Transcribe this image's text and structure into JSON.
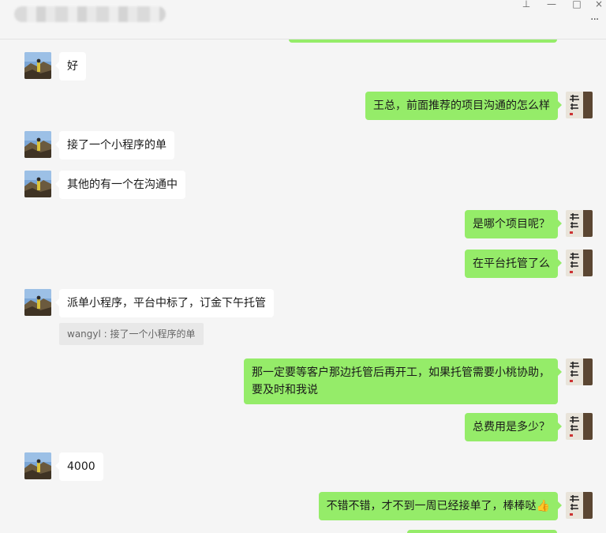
{
  "window": {
    "controls": {
      "pin_icon": "pin-icon",
      "min_icon": "minimize-icon",
      "max_icon": "maximize-icon",
      "close_icon": "close-icon",
      "more_icon": "more-icon"
    }
  },
  "colors": {
    "background": "#f5f5f5",
    "outgoing_bubble": "#95ec69",
    "incoming_bubble": "#ffffff",
    "quote_background": "#e8e8e8"
  },
  "messages": [
    {
      "direction": "in",
      "text": "好"
    },
    {
      "direction": "out",
      "text": "王总，前面推荐的项目沟通的怎么样"
    },
    {
      "direction": "in",
      "text": "接了一个小程序的单"
    },
    {
      "direction": "in",
      "text": "其他的有一个在沟通中"
    },
    {
      "direction": "out",
      "text": "是哪个项目呢？"
    },
    {
      "direction": "out",
      "text": "在平台托管了么"
    },
    {
      "direction": "in",
      "text": "派单小程序，平台中标了，订金下午托管",
      "quote": "wangyl : 接了一个小程序的单"
    },
    {
      "direction": "out",
      "text": "那一定要等客户那边托管后再开工，如果托管需要小桃协助，要及时和我说"
    },
    {
      "direction": "out",
      "text": "总费用是多少？"
    },
    {
      "direction": "in",
      "text": "4000"
    },
    {
      "direction": "out",
      "text": "不错不错，才不到一周已经接单了，棒棒哒",
      "emoji": "👍"
    }
  ]
}
